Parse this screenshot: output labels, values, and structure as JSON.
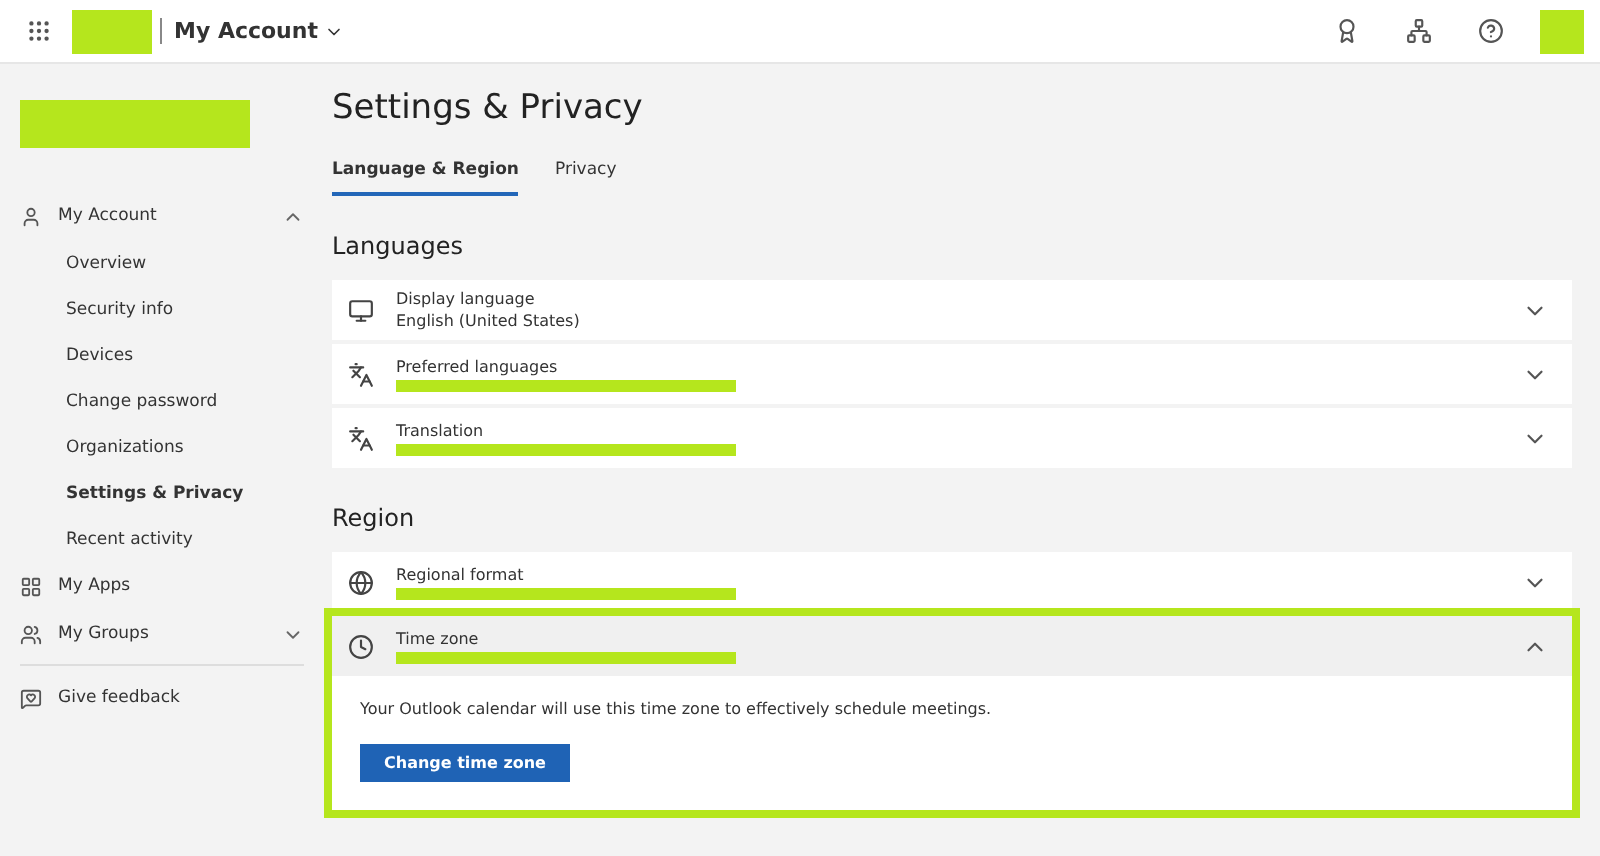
{
  "top_bar": {
    "app_title": "My Account"
  },
  "sidebar": {
    "items": [
      {
        "label": "My Account",
        "kind": "group",
        "expanded": true,
        "children": [
          {
            "label": "Overview",
            "selected": false
          },
          {
            "label": "Security info",
            "selected": false
          },
          {
            "label": "Devices",
            "selected": false
          },
          {
            "label": "Change password",
            "selected": false
          },
          {
            "label": "Organizations",
            "selected": false
          },
          {
            "label": "Settings & Privacy",
            "selected": true
          },
          {
            "label": "Recent activity",
            "selected": false
          }
        ]
      },
      {
        "label": "My Apps",
        "kind": "link"
      },
      {
        "label": "My Groups",
        "kind": "group",
        "expanded": false
      },
      {
        "label": "Give feedback",
        "kind": "link"
      }
    ]
  },
  "page": {
    "title": "Settings & Privacy",
    "tabs": [
      {
        "label": "Language & Region",
        "selected": true
      },
      {
        "label": "Privacy",
        "selected": false
      }
    ],
    "sections": [
      {
        "heading": "Languages",
        "rows": [
          {
            "label": "Display language",
            "value": "English (United States)",
            "expanded": false
          },
          {
            "label": "Preferred languages",
            "redacted": true,
            "expanded": false
          },
          {
            "label": "Translation",
            "redacted": true,
            "expanded": false
          }
        ]
      },
      {
        "heading": "Region",
        "rows": [
          {
            "label": "Regional format",
            "redacted": true,
            "expanded": false
          },
          {
            "label": "Time zone",
            "redacted": true,
            "expanded": true,
            "highlighted": true,
            "description": "Your Outlook calendar will use this time zone to effectively schedule meetings.",
            "button": "Change time zone"
          }
        ]
      }
    ]
  }
}
